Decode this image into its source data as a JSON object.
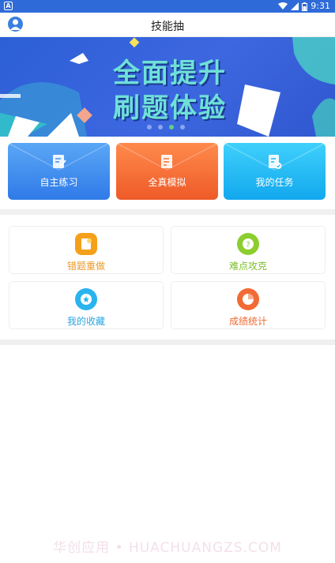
{
  "status_bar": {
    "time": "9:31",
    "app_badge": "A"
  },
  "header": {
    "title": "技能抽",
    "avatar_icon": "user-avatar-icon"
  },
  "banner": {
    "line1": "全面提升",
    "line2": "刷题体验",
    "slides": 4,
    "active_slide": 3
  },
  "mode_cards": [
    {
      "label": "自主练习",
      "icon": "edit-note-icon",
      "color": "#3f8cf0"
    },
    {
      "label": "全真模拟",
      "icon": "exam-sheet-icon",
      "color": "#f56e33"
    },
    {
      "label": "我的任务",
      "icon": "task-check-icon",
      "color": "#1fb6f3"
    }
  ],
  "tools": [
    {
      "label": "错题重做",
      "icon": "redo-note-icon",
      "color": "#f5a01a",
      "text_color": "#e89a2a"
    },
    {
      "label": "难点攻克",
      "icon": "question-icon",
      "color": "#8ccd2f",
      "text_color": "#7bbf2a"
    },
    {
      "label": "我的收藏",
      "icon": "star-icon",
      "color": "#2ab4ee",
      "text_color": "#2aa6e0"
    },
    {
      "label": "成绩统计",
      "icon": "pie-chart-icon",
      "color": "#f26b35",
      "text_color": "#ee6a32"
    }
  ],
  "watermark": "华创应用 • HUACHUANGZS.COM"
}
